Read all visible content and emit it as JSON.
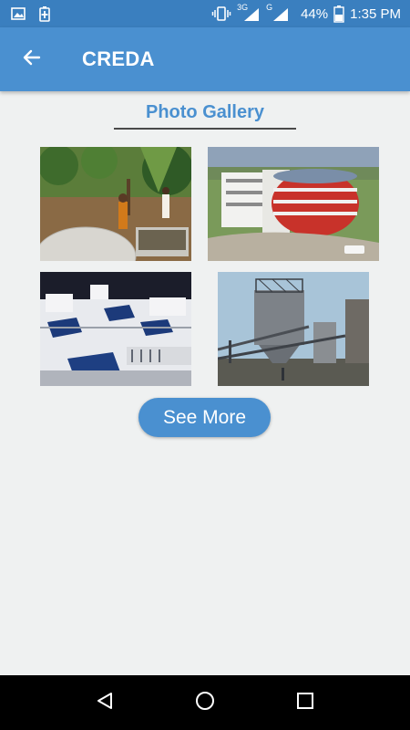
{
  "status_bar": {
    "network_3g": "3G",
    "network_g": "G",
    "battery": "44%",
    "time": "1:35 PM",
    "icons": [
      "gallery-icon",
      "battery-saver-icon",
      "vibrate-icon",
      "signal-icon",
      "signal-icon",
      "battery-icon"
    ]
  },
  "app_bar": {
    "title": "CREDA",
    "back_icon": "arrow-left-icon"
  },
  "gallery": {
    "title": "Photo Gallery",
    "photos": [
      {
        "subject": "biogas plant with people"
      },
      {
        "subject": "modern office building"
      },
      {
        "subject": "rooftop solar water heaters"
      },
      {
        "subject": "industrial plant"
      }
    ],
    "see_more_label": "See More"
  },
  "nav_bar": {
    "icons": [
      "back-triangle-icon",
      "home-circle-icon",
      "recents-square-icon"
    ]
  },
  "colors": {
    "status_bar": "#3a7fbf",
    "app_bar": "#4a90d0",
    "accent": "#4a90d0",
    "background": "#eff1f1"
  }
}
